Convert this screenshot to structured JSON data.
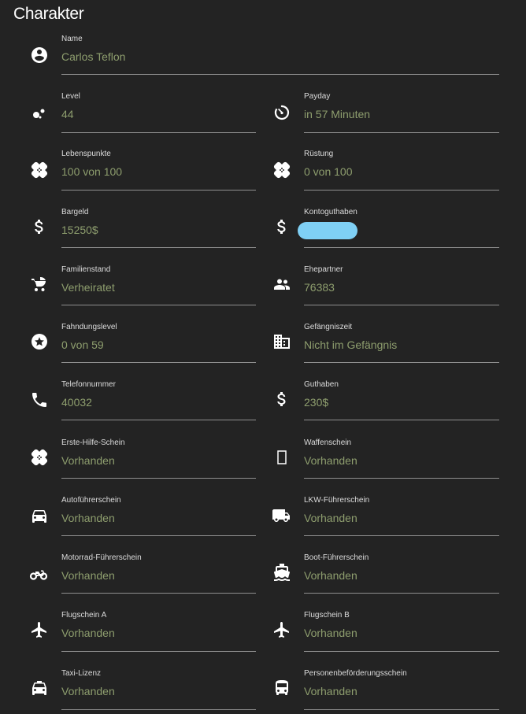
{
  "page": {
    "title": "Charakter"
  },
  "fields": {
    "name": {
      "label": "Name",
      "value": "Carlos Teflon"
    },
    "level": {
      "label": "Level",
      "value": "44"
    },
    "payday": {
      "label": "Payday",
      "value": "in 57 Minuten"
    },
    "lebenspunkte": {
      "label": "Lebenspunkte",
      "value": "100 von 100"
    },
    "ruestung": {
      "label": "Rüstung",
      "value": "0 von 100"
    },
    "bargeld": {
      "label": "Bargeld",
      "value": "15250$"
    },
    "kontoguthaben": {
      "label": "Kontoguthaben",
      "value": ""
    },
    "familienstand": {
      "label": "Familienstand",
      "value": "Verheiratet"
    },
    "ehepartner": {
      "label": "Ehepartner",
      "value": "76383"
    },
    "fahndungslevel": {
      "label": "Fahndungslevel",
      "value": "0 von 59"
    },
    "gefaengniszeit": {
      "label": "Gefängniszeit",
      "value": "Nicht im Gefängnis"
    },
    "telefonnummer": {
      "label": "Telefonnummer",
      "value": "40032"
    },
    "guthaben": {
      "label": "Guthaben",
      "value": "230$"
    },
    "erste_hilfe": {
      "label": "Erste-Hilfe-Schein",
      "value": "Vorhanden"
    },
    "waffenschein": {
      "label": "Waffenschein",
      "value": "Vorhanden"
    },
    "auto": {
      "label": "Autoführerschein",
      "value": "Vorhanden"
    },
    "lkw": {
      "label": "LKW-Führerschein",
      "value": "Vorhanden"
    },
    "motorrad": {
      "label": "Motorrad-Führerschein",
      "value": "Vorhanden"
    },
    "boot": {
      "label": "Boot-Führerschein",
      "value": "Vorhanden"
    },
    "flug_a": {
      "label": "Flugschein A",
      "value": "Vorhanden"
    },
    "flug_b": {
      "label": "Flugschein B",
      "value": "Vorhanden"
    },
    "taxi": {
      "label": "Taxi-Lizenz",
      "value": "Vorhanden"
    },
    "personen": {
      "label": "Personenbeförderungsschein",
      "value": "Vorhanden"
    }
  },
  "icons": {
    "name": "account-circle-icon",
    "level": "bubbles-icon",
    "payday": "timer-icon",
    "lebenspunkte": "bandage-icon",
    "ruestung": "bandage-icon",
    "bargeld": "dollar-icon",
    "kontoguthaben": "dollar-icon",
    "familienstand": "stroller-icon",
    "ehepartner": "people-icon",
    "fahndungslevel": "star-circle-icon",
    "gefaengniszeit": "building-icon",
    "telefonnummer": "phone-icon",
    "guthaben": "dollar-icon",
    "erste_hilfe": "bandage-icon",
    "waffenschein": "crop-portrait-icon",
    "auto": "car-icon",
    "lkw": "truck-icon",
    "motorrad": "motorcycle-icon",
    "boot": "ferry-icon",
    "flug_a": "airplane-icon",
    "flug_b": "airplane-icon",
    "taxi": "taxi-icon",
    "personen": "bus-icon"
  },
  "colors": {
    "background": "#232323",
    "label": "#dcdcdc",
    "value": "#8e9e6e",
    "underline": "#8f8f8f",
    "redaction": "#7fd0f5"
  }
}
